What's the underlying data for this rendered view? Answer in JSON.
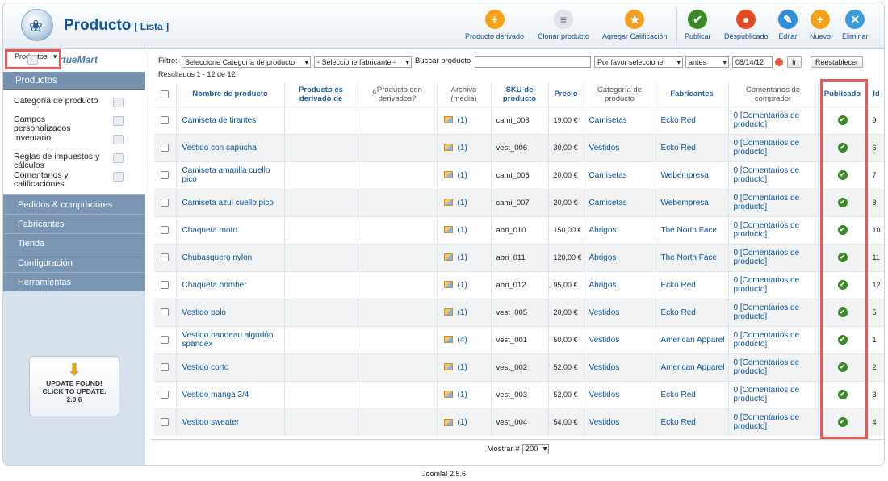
{
  "header": {
    "title": "Producto",
    "subtitle": "[ Lista ]",
    "toolbar": [
      {
        "label": "Producto derivado",
        "color": "#f5a21b",
        "glyph": "+",
        "icon": "plus-orange-icon"
      },
      {
        "label": "Clonar producto",
        "color": "#dfe4ea",
        "glyph": "≡",
        "icon": "clone-icon"
      },
      {
        "label": "Agregar Calificación",
        "color": "#f0a020",
        "glyph": "★",
        "icon": "star-icon"
      },
      {
        "label": "Publicar",
        "color": "#3a8a25",
        "glyph": "✔",
        "icon": "publish-check-icon"
      },
      {
        "label": "Despublicado",
        "color": "#e34a1f",
        "glyph": "●",
        "icon": "unpublish-icon"
      },
      {
        "label": "Editar",
        "color": "#2f8cd5",
        "glyph": "✎",
        "icon": "edit-pencil-icon"
      },
      {
        "label": "Nuevo",
        "color": "#f5a21b",
        "glyph": "+",
        "icon": "new-plus-icon"
      },
      {
        "label": "Eliminar",
        "color": "#3a9bd8",
        "glyph": "✕",
        "icon": "trash-icon"
      }
    ]
  },
  "sidebar": {
    "logo": "VirtueMart",
    "section": "Productos",
    "items": [
      {
        "label": "Categoría de producto",
        "selected": false
      },
      {
        "label": "Productos",
        "selected": true
      },
      {
        "label": "Campos personalizados",
        "selected": false
      },
      {
        "label": "Inventario",
        "selected": false
      },
      {
        "label": "Reglas de impuestos y cálculos",
        "selected": false
      },
      {
        "label": "Comentarios y calificaciónes",
        "selected": false
      }
    ],
    "groups": [
      "Pedidos & compradores",
      "Fabricantes",
      "Tienda",
      "Configuración",
      "Herramientas"
    ],
    "update": {
      "line1": "UPDATE FOUND!",
      "line2": "CLICK TO UPDATE.",
      "version": "2.0.6"
    }
  },
  "filters": {
    "label": "Filtro:",
    "category": "Seleccione Categoría de producto",
    "manufacturer": "- Seleccione fabricante -",
    "search_label": "Buscar producto",
    "search_value": "",
    "date_select": "Por favor seleccione",
    "when": "antes",
    "date": "08/14/12",
    "go": "Ir",
    "reset": "Reestablecer",
    "results": "Resultados 1 - 12 de 12"
  },
  "table": {
    "headers": [
      "Nombre de producto",
      "Producto es derivado de",
      "¿Producto con derivados?",
      "Archivo (media)",
      "SKU de producto",
      "Precio",
      "Categoría de producto",
      "Fabricantes",
      "Comentarios de comprador",
      "Publicado",
      "Id"
    ],
    "rows": [
      {
        "name": "Camiseta de tirantes",
        "media": "(1)",
        "sku": "cami_008",
        "price": "19,00 €",
        "category": "Camisetas",
        "manufacturer": "Ecko Red",
        "reviews": "0 [Comentarios de producto]",
        "id": "9"
      },
      {
        "name": "Vestido con capucha",
        "media": "(1)",
        "sku": "vest_006",
        "price": "30,00 €",
        "category": "Vestidos",
        "manufacturer": "Ecko Red",
        "reviews": "0 [Comentarios de producto]",
        "id": "6"
      },
      {
        "name": "Camiseta amarilla cuello pico",
        "media": "(1)",
        "sku": "cami_006",
        "price": "20,00 €",
        "category": "Camisetas",
        "manufacturer": "Webempresa",
        "reviews": "0 [Comentarios de producto]",
        "id": "7"
      },
      {
        "name": "Camiseta azul cuello pico",
        "media": "(1)",
        "sku": "cami_007",
        "price": "20,00 €",
        "category": "Camisetas",
        "manufacturer": "Webempresa",
        "reviews": "0 [Comentarios de producto]",
        "id": "8"
      },
      {
        "name": "Chaqueta moto",
        "media": "(1)",
        "sku": "abri_010",
        "price": "150,00 €",
        "category": "Abrigos",
        "manufacturer": "The North Face",
        "reviews": "0 [Comentarios de producto]",
        "id": "10"
      },
      {
        "name": "Chubasquero nylon",
        "media": "(1)",
        "sku": "abri_011",
        "price": "120,00 €",
        "category": "Abrigos",
        "manufacturer": "The North Face",
        "reviews": "0 [Comentarios de producto]",
        "id": "11"
      },
      {
        "name": "Chaqueta bomber",
        "media": "(1)",
        "sku": "abri_012",
        "price": "95,00 €",
        "category": "Abrigos",
        "manufacturer": "Ecko Red",
        "reviews": "0 [Comentarios de producto]",
        "id": "12"
      },
      {
        "name": "Vestido polo",
        "media": "(1)",
        "sku": "vest_005",
        "price": "20,00 €",
        "category": "Vestidos",
        "manufacturer": "Ecko Red",
        "reviews": "0 [Comentarios de producto]",
        "id": "5"
      },
      {
        "name": "Vestido bandeau algodón spandex",
        "media": "(4)",
        "sku": "vest_001",
        "price": "50,00 €",
        "category": "Vestidos",
        "manufacturer": "American Apparel",
        "reviews": "0 [Comentarios de producto]",
        "id": "1"
      },
      {
        "name": "Vestido corto",
        "media": "(1)",
        "sku": "vest_002",
        "price": "52,00 €",
        "category": "Vestidos",
        "manufacturer": "American Apparel",
        "reviews": "0 [Comentarios de producto]",
        "id": "2"
      },
      {
        "name": "Vestido manga 3/4",
        "media": "(1)",
        "sku": "vest_003",
        "price": "52,00 €",
        "category": "Vestidos",
        "manufacturer": "Ecko Red",
        "reviews": "0 [Comentarios de producto]",
        "id": "3"
      },
      {
        "name": "Vestido sweater",
        "media": "(1)",
        "sku": "vest_004",
        "price": "54,00 €",
        "category": "Vestidos",
        "manufacturer": "Ecko Red",
        "reviews": "0 [Comentarios de producto]",
        "id": "4"
      }
    ]
  },
  "pagination": {
    "label": "Mostrar #",
    "value": "200"
  },
  "footer": {
    "version": "Joomla! 2.5.6"
  }
}
